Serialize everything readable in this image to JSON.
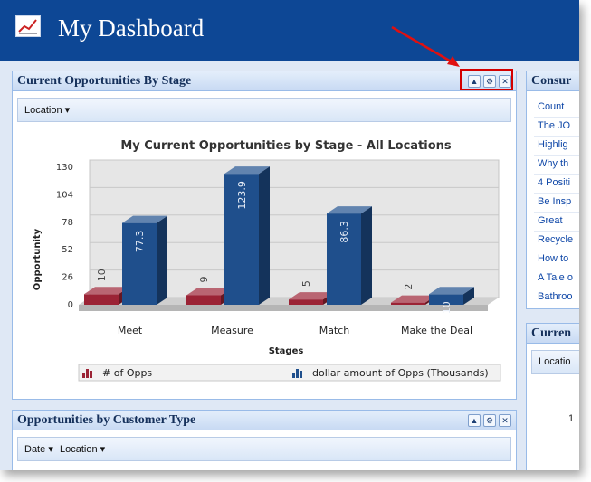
{
  "app": {
    "title": "My Dashboard"
  },
  "panels": {
    "opportunities": {
      "title": "Current Opportunities By Stage",
      "toolbar": {
        "location": "Location"
      },
      "tools": [
        "▲",
        "⚙",
        "✕"
      ]
    },
    "customer_type": {
      "title": "Opportunities by Customer Type",
      "toolbar": {
        "date": "Date",
        "location": "Location"
      }
    },
    "consumer": {
      "title": "Consur",
      "items": [
        "Count",
        "The JO",
        "Highlig",
        "Why th",
        "4 Positi",
        "Be Insp",
        "Great",
        "Recycle",
        "How to",
        "A Tale o",
        "Bathroo"
      ]
    },
    "current": {
      "title": "Curren",
      "toolbar": {
        "location": "Locatio"
      },
      "value": "1"
    }
  },
  "chart_data": {
    "type": "bar",
    "title": "My Current Opportunities by Stage - All Locations",
    "xlabel": "Stages",
    "ylabel": "Opportunity",
    "ylim": [
      0,
      130
    ],
    "yticks": [
      0,
      26,
      52,
      78,
      104,
      130
    ],
    "categories": [
      "Meet",
      "Measure",
      "Match",
      "Make the Deal"
    ],
    "series": [
      {
        "name": "# of Opps",
        "values": [
          10,
          9,
          5,
          2
        ],
        "color": "#9b2335"
      },
      {
        "name": "dollar amount of Opps (Thousands)",
        "values": [
          77.3,
          123.9,
          86.3,
          10
        ],
        "color": "#1f4f8c"
      }
    ],
    "legend": "bottom"
  }
}
